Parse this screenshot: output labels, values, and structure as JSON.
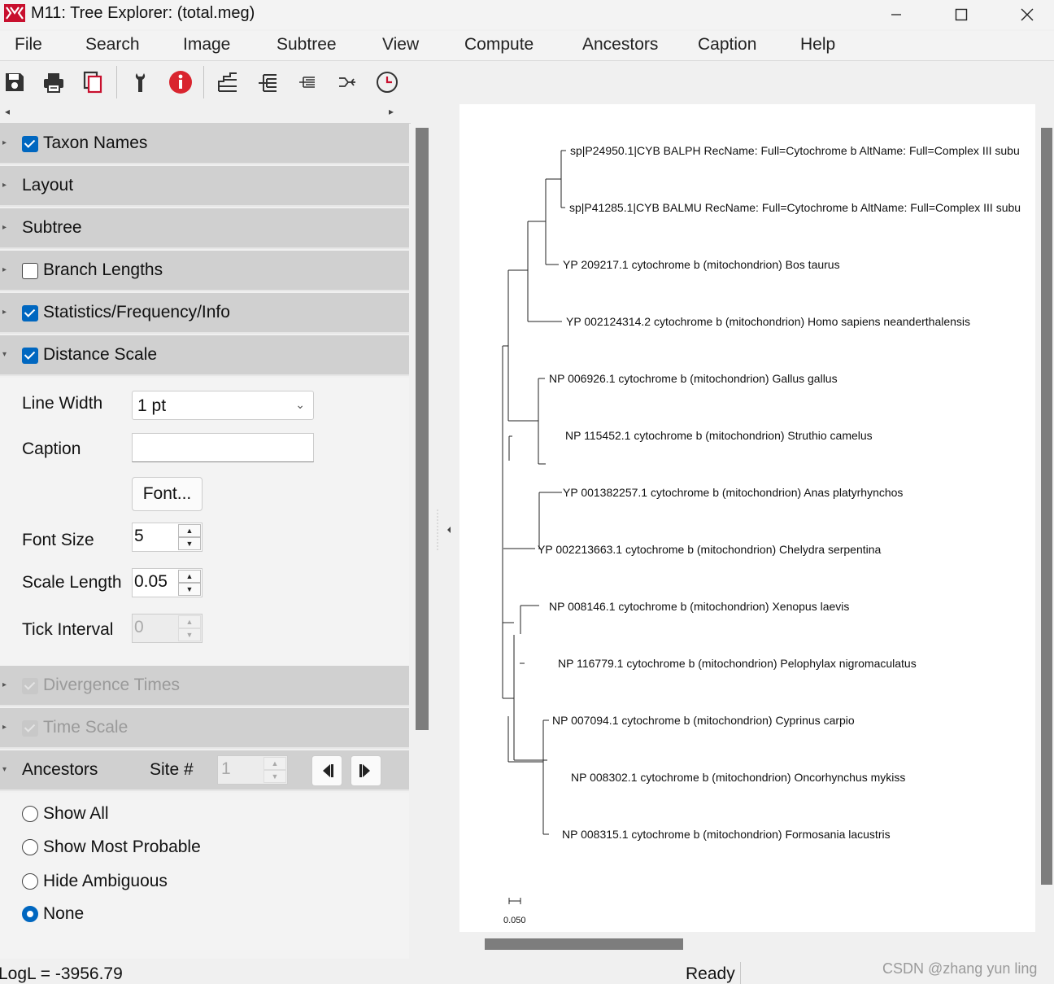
{
  "window": {
    "title": "M11: Tree Explorer: (total.meg)"
  },
  "menu": [
    "File",
    "Search",
    "Image",
    "Subtree",
    "View",
    "Compute",
    "Ancestors",
    "Caption",
    "Help"
  ],
  "toolbar": {
    "icons": [
      "save-icon",
      "print-icon",
      "copy-icon",
      "options-icon",
      "info-icon",
      "tree-layout-icon",
      "tree-layout-alt-icon",
      "compressed-tree-icon",
      "radiation-tree-icon",
      "timetree-icon"
    ]
  },
  "sections": {
    "taxon_names": "Taxon Names",
    "layout": "Layout",
    "subtree": "Subtree",
    "branch_lengths": "Branch Lengths",
    "statistics": "Statistics/Frequency/Info",
    "distance_scale": "Distance Scale",
    "divergence_times": "Divergence Times",
    "time_scale": "Time Scale",
    "ancestors": "Ancestors"
  },
  "distance_scale": {
    "line_width_label": "Line Width",
    "line_width_value": "1 pt",
    "caption_label": "Caption",
    "caption_value": "",
    "font_button": "Font...",
    "font_size_label": "Font Size",
    "font_size_value": "5",
    "scale_length_label": "Scale Length",
    "scale_length_value": "0.05",
    "tick_interval_label": "Tick Interval",
    "tick_interval_value": "0"
  },
  "ancestors": {
    "site_label": "Site #",
    "site_value": "1",
    "options": [
      "Show All",
      "Show Most Probable",
      "Hide Ambiguous",
      "None"
    ],
    "selected": "None"
  },
  "tree": {
    "taxa": [
      "sp|P24950.1|CYB BALPH RecName: Full=Cytochrome b AltName: Full=Complex III subu",
      "sp|P41285.1|CYB BALMU RecName: Full=Cytochrome b AltName: Full=Complex III subu",
      "YP 209217.1 cytochrome b (mitochondrion) Bos taurus",
      "YP 002124314.2 cytochrome b (mitochondrion) Homo sapiens neanderthalensis",
      "NP 006926.1 cytochrome b (mitochondrion) Gallus gallus",
      "NP 115452.1 cytochrome b (mitochondrion) Struthio camelus",
      "YP 001382257.1 cytochrome b (mitochondrion) Anas platyrhynchos",
      "YP 002213663.1 cytochrome b (mitochondrion) Chelydra serpentina",
      "NP 008146.1 cytochrome b (mitochondrion) Xenopus laevis",
      "NP 116779.1 cytochrome b (mitochondrion) Pelophylax nigromaculatus",
      "NP 007094.1 cytochrome b (mitochondrion) Cyprinus carpio",
      "NP 008302.1 cytochrome b (mitochondrion) Oncorhynchus mykiss",
      "NP 008315.1 cytochrome b (mitochondrion) Formosania lacustris"
    ],
    "scale_label": "0.050"
  },
  "status": {
    "left": "LogL = -3956.79",
    "right": "Ready"
  },
  "watermark": "CSDN @zhang yun ling",
  "colors": {
    "accent": "#0067c0",
    "logo": "#c8102e",
    "info": "#d9252f"
  }
}
